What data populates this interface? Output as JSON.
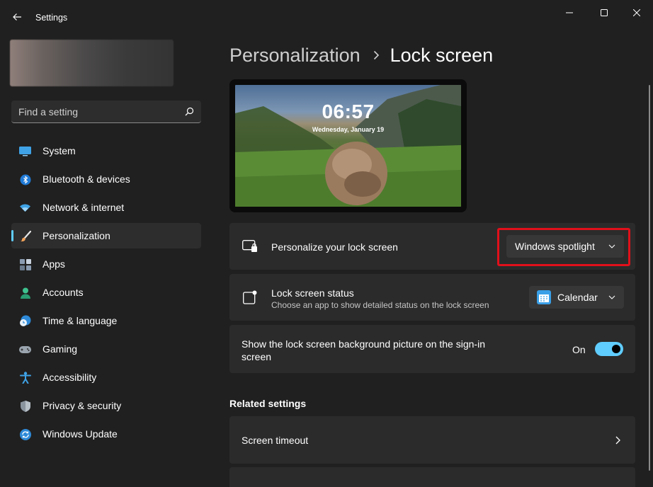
{
  "window": {
    "title": "Settings",
    "controls": {
      "minimize": "minimize-icon",
      "maximize": "maximize-icon",
      "close": "close-icon"
    }
  },
  "search": {
    "placeholder": "Find a setting"
  },
  "sidebar": {
    "items": [
      {
        "label": "System",
        "icon": "system-icon"
      },
      {
        "label": "Bluetooth & devices",
        "icon": "bluetooth-icon"
      },
      {
        "label": "Network & internet",
        "icon": "wifi-icon"
      },
      {
        "label": "Personalization",
        "icon": "brush-icon",
        "active": true
      },
      {
        "label": "Apps",
        "icon": "apps-icon"
      },
      {
        "label": "Accounts",
        "icon": "account-icon"
      },
      {
        "label": "Time & language",
        "icon": "clock-globe-icon"
      },
      {
        "label": "Gaming",
        "icon": "gamepad-icon"
      },
      {
        "label": "Accessibility",
        "icon": "accessibility-icon"
      },
      {
        "label": "Privacy & security",
        "icon": "shield-icon"
      },
      {
        "label": "Windows Update",
        "icon": "update-icon"
      }
    ]
  },
  "breadcrumb": {
    "parent": "Personalization",
    "current": "Lock screen"
  },
  "preview": {
    "time": "06:57",
    "date": "Wednesday, January 19"
  },
  "settings": {
    "personalize": {
      "title": "Personalize your lock screen",
      "value": "Windows spotlight"
    },
    "status": {
      "title": "Lock screen status",
      "subtitle": "Choose an app to show detailed status on the lock screen",
      "value": "Calendar"
    },
    "signin_bg": {
      "title": "Show the lock screen background picture on the sign-in screen",
      "state": "On",
      "enabled": true
    }
  },
  "related": {
    "heading": "Related settings",
    "items": [
      {
        "label": "Screen timeout"
      }
    ]
  },
  "colors": {
    "accent": "#60cdff",
    "highlight": "#e0101b",
    "background": "#202020",
    "card": "#2b2b2b"
  }
}
